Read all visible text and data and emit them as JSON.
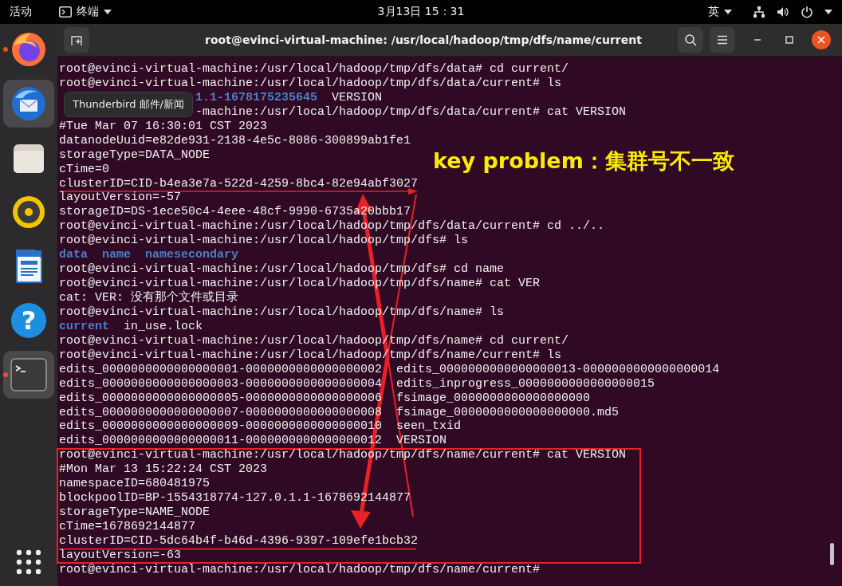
{
  "top_bar": {
    "activities": "活动",
    "app_menu": "终端",
    "clock": "3月13日  15：31",
    "input_method": "英"
  },
  "dock": {
    "items": [
      {
        "kind": "browser",
        "running": true,
        "highlighted": false
      },
      {
        "kind": "mail",
        "running": false,
        "highlighted": true
      },
      {
        "kind": "files",
        "running": false,
        "highlighted": false
      },
      {
        "kind": "music",
        "running": false,
        "highlighted": false
      },
      {
        "kind": "writer",
        "running": false,
        "highlighted": false
      },
      {
        "kind": "help",
        "running": false,
        "highlighted": false,
        "glyph": "?"
      },
      {
        "kind": "terminal",
        "running": true,
        "highlighted": true
      }
    ]
  },
  "terminal": {
    "title": "root@evinci-virtual-machine: /usr/local/hadoop/tmp/dfs/name/current",
    "tooltip": "Thunderbird 邮件/新闻",
    "lines": [
      {
        "text": "root@evinci-virtual-machine:/usr/local/hadoop/tmp/dfs/data# cd current/"
      },
      {
        "text": "root@evinci-virtual-machine:/usr/local/hadoop/tmp/dfs/data/current# ls"
      },
      {
        "behind_tooltip": true,
        "parts": [
          {
            "text": "1.1-1678175235645",
            "kind": "dir"
          },
          {
            "text": "  VERSION",
            "kind": "plain"
          }
        ]
      },
      {
        "behind_tooltip": true,
        "text": "-machine:/usr/local/hadoop/tmp/dfs/data/current# cat VERSION"
      },
      {
        "text": "#Tue Mar 07 16:30:01 CST 2023"
      },
      {
        "text": "datanodeUuid=e82de931-2138-4e5c-8086-300899ab1fe1"
      },
      {
        "text": "storageType=DATA_NODE"
      },
      {
        "text": "cTime=0"
      },
      {
        "text": "clusterID=CID-b4ea3e7a-522d-4259-8bc4-82e94abf3027"
      },
      {
        "text": "layoutVersion=-57"
      },
      {
        "text": "storageID=DS-1ece50c4-4eee-48cf-9990-6735a20bbb17"
      },
      {
        "text": "root@evinci-virtual-machine:/usr/local/hadoop/tmp/dfs/data/current# cd ../.."
      },
      {
        "text": "root@evinci-virtual-machine:/usr/local/hadoop/tmp/dfs# ls"
      },
      {
        "parts": [
          {
            "text": "data",
            "kind": "dir"
          },
          {
            "text": "name",
            "kind": "dir"
          },
          {
            "text": "namesecondary",
            "kind": "dir"
          }
        ]
      },
      {
        "text": "root@evinci-virtual-machine:/usr/local/hadoop/tmp/dfs# cd name"
      },
      {
        "text": "root@evinci-virtual-machine:/usr/local/hadoop/tmp/dfs/name# cat VER"
      },
      {
        "text": "cat: VER: 没有那个文件或目录"
      },
      {
        "text": "root@evinci-virtual-machine:/usr/local/hadoop/tmp/dfs/name# ls"
      },
      {
        "parts": [
          {
            "text": "current",
            "kind": "dir"
          },
          {
            "text": "  in_use.lock",
            "kind": "plain"
          }
        ]
      },
      {
        "text": "root@evinci-virtual-machine:/usr/local/hadoop/tmp/dfs/name# cd current/"
      },
      {
        "text": "root@evinci-virtual-machine:/usr/local/hadoop/tmp/dfs/name/current# ls"
      },
      {
        "text": "edits_0000000000000000001-0000000000000000002  edits_0000000000000000013-0000000000000000014"
      },
      {
        "text": "edits_0000000000000000003-0000000000000000004  edits_inprogress_0000000000000000015"
      },
      {
        "text": "edits_0000000000000000005-0000000000000000006  fsimage_0000000000000000000"
      },
      {
        "text": "edits_0000000000000000007-0000000000000000008  fsimage_0000000000000000000.md5"
      },
      {
        "text": "edits_0000000000000000009-0000000000000000010  seen_txid"
      },
      {
        "text": "edits_0000000000000000011-0000000000000000012  VERSION"
      },
      {
        "text": "root@evinci-virtual-machine:/usr/local/hadoop/tmp/dfs/name/current# cat VERSION"
      },
      {
        "text": "#Mon Mar 13 15:22:24 CST 2023"
      },
      {
        "text": "namespaceID=680481975"
      },
      {
        "text": "blockpoolID=BP-1554318774-127.0.1.1-1678692144877"
      },
      {
        "text": "storageType=NAME_NODE"
      },
      {
        "text": "cTime=1678692144877"
      },
      {
        "text": "clusterID=CID-5dc64b4f-b46d-4396-9397-109efe1bcb32"
      },
      {
        "text": "layoutVersion=-63"
      },
      {
        "text": "root@evinci-virtual-machine:/usr/local/hadoop/tmp/dfs/name/current#"
      }
    ]
  },
  "annotation": {
    "label": "key problem：集群号不一致"
  }
}
